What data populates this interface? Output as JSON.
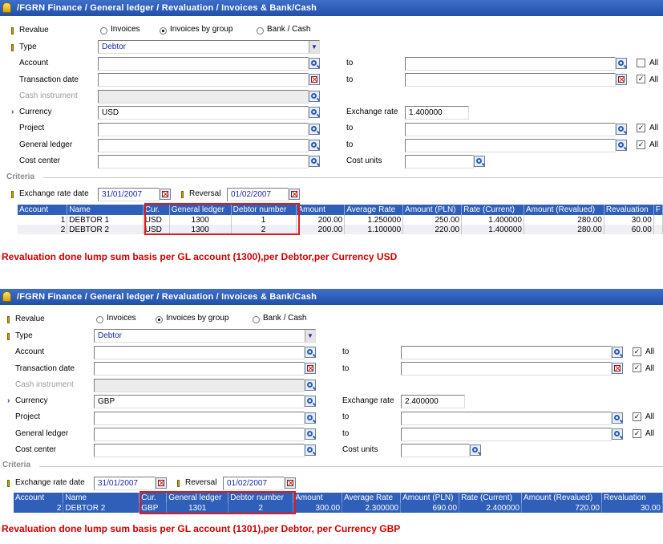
{
  "panels": [
    {
      "title": "/FGRN  Finance / General ledger / Revaluation / Invoices & Bank/Cash",
      "revalue_label": "Revalue",
      "revalue_options": [
        "Invoices",
        "Invoices by group",
        "Bank / Cash"
      ],
      "revalue_selected": 1,
      "type_label": "Type",
      "type_value": "Debtor",
      "account_label": "Account",
      "transaction_date_label": "Transaction date",
      "cash_instrument_label": "Cash instrument",
      "currency_label": "Currency",
      "currency_value": "USD",
      "exchange_rate_label": "Exchange rate",
      "exchange_rate_value": "1.400000",
      "project_label": "Project",
      "general_ledger_label": "General ledger",
      "cost_center_label": "Cost center",
      "cost_units_label": "Cost units",
      "to_label": "to",
      "all_label": "All",
      "all_checked": {
        "account": false,
        "transaction_date": true,
        "project": true,
        "general_ledger": true
      },
      "criteria_label": "Criteria",
      "exchange_rate_date_label": "Exchange rate date",
      "exchange_rate_date_value": "31/01/2007",
      "reversal_label": "Reversal",
      "reversal_value": "01/02/2007",
      "columns": [
        "Account",
        "Name",
        "Cur.",
        "General ledger",
        "Debtor number",
        "Amount",
        "Average Rate",
        "Amount (PLN)",
        "Rate (Current)",
        "Amount (Revalued)",
        "Revaluation",
        "F"
      ],
      "rows": [
        [
          "1",
          "DEBTOR 1",
          "USD",
          "1300",
          "1",
          "200.00",
          "1.250000",
          "250.00",
          "1.400000",
          "280.00",
          "30.00",
          ""
        ],
        [
          "2",
          "DEBTOR 2",
          "USD",
          "1300",
          "2",
          "200.00",
          "1.100000",
          "220.00",
          "1.400000",
          "280.00",
          "60.00",
          ""
        ]
      ],
      "caption": "Revaluation done lump sum basis per GL account (1300),per Debtor,per Currency USD"
    },
    {
      "title": "/FGRN  Finance / General ledger / Revaluation / Invoices & Bank/Cash",
      "revalue_label": "Revalue",
      "revalue_options": [
        "Invoices",
        "Invoices by group",
        "Bank / Cash"
      ],
      "revalue_selected": 1,
      "type_label": "Type",
      "type_value": "Debtor",
      "account_label": "Account",
      "transaction_date_label": "Transaction date",
      "cash_instrument_label": "Cash instrument",
      "currency_label": "Currency",
      "currency_value": "GBP",
      "exchange_rate_label": "Exchange rate",
      "exchange_rate_value": "2.400000",
      "project_label": "Project",
      "general_ledger_label": "General ledger",
      "cost_center_label": "Cost center",
      "cost_units_label": "Cost units",
      "to_label": "to",
      "all_label": "All",
      "all_checked": {
        "account": true,
        "transaction_date": true,
        "project": true,
        "general_ledger": true
      },
      "criteria_label": "Criteria",
      "exchange_rate_date_label": "Exchange rate date",
      "exchange_rate_date_value": "31/01/2007",
      "reversal_label": "Reversal",
      "reversal_value": "01/02/2007",
      "columns": [
        "Account",
        "Name",
        "Cur.",
        "General ledger",
        "Debtor number",
        "Amount",
        "Average Rate",
        "Amount (PLN)",
        "Rate (Current)",
        "Amount (Revalued)",
        "Revaluation"
      ],
      "rows": [
        [
          "2",
          "DEBTOR 2",
          "GBP",
          "1301",
          "2",
          "300.00",
          "2.300000",
          "690.00",
          "2.400000",
          "720.00",
          "30.00"
        ]
      ],
      "caption": "Revaluation done lump sum basis per GL account (1301),per Debtor, per Currency GBP"
    }
  ]
}
